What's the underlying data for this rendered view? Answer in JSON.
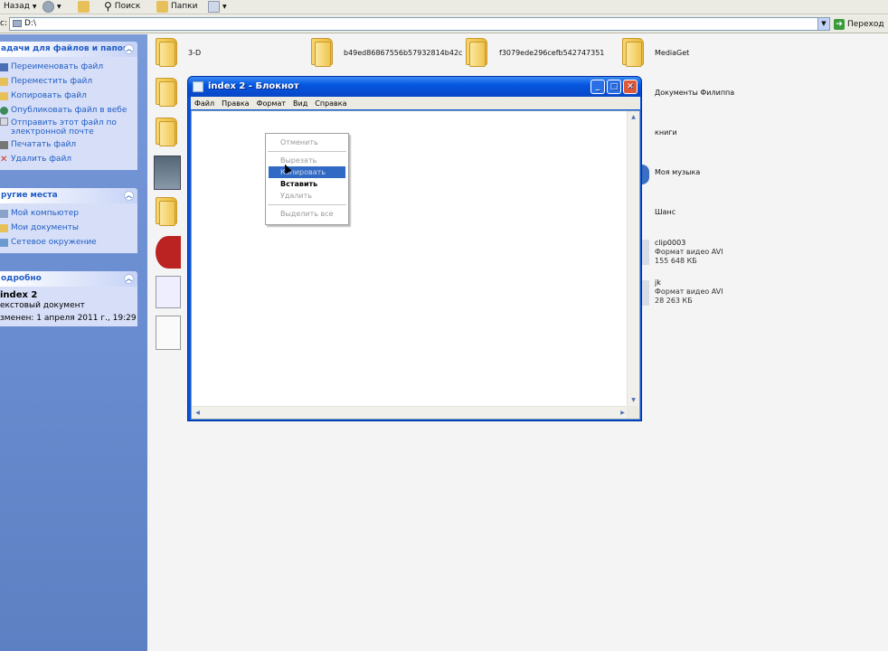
{
  "toolbar": {
    "back_label": "Назад",
    "search_label": "Поиск",
    "folders_label": "Папки"
  },
  "address": {
    "prefix": "с:",
    "value": "D:\\",
    "go_label": "Переход"
  },
  "tasks_panel": {
    "title": "адачи для файлов и папок",
    "items": [
      {
        "label": "Переименовать файл",
        "icon": "rename-icon"
      },
      {
        "label": "Переместить файл",
        "icon": "move-icon"
      },
      {
        "label": "Копировать файл",
        "icon": "copy-icon"
      },
      {
        "label": "Опубликовать файл в вебе",
        "icon": "web-icon"
      },
      {
        "label": "Отправить этот файл по электронной почте",
        "icon": "mail-icon"
      },
      {
        "label": "Печатать файл",
        "icon": "print-icon"
      },
      {
        "label": "Удалить файл",
        "icon": "delete-icon"
      }
    ]
  },
  "places_panel": {
    "title": "ругие места",
    "items": [
      {
        "label": "Мой компьютер",
        "icon": "computer-icon"
      },
      {
        "label": "Мои документы",
        "icon": "documents-icon"
      },
      {
        "label": "Сетевое окружение",
        "icon": "network-icon"
      }
    ]
  },
  "details_panel": {
    "title": "одробно",
    "name": "index 2",
    "type": "екстовый документ",
    "modified": "зменен: 1 апреля 2011 г., 19:29"
  },
  "files": {
    "f1": {
      "name": "3-D"
    },
    "f2": {
      "name": "b49ed86867556b57932814b42c"
    },
    "f3": {
      "name": "f3079ede296cefb542747351"
    },
    "f4": {
      "name": "MediaGet"
    },
    "f5": {
      "name": "Документы Филиппа"
    },
    "f6": {
      "name": "книги"
    },
    "f7": {
      "name": "Моя музыка"
    },
    "f8": {
      "name": "Шанс"
    },
    "f9": {
      "name": "clip0003",
      "type": "Формат видео AVI",
      "size": "155 648 КБ"
    },
    "f10": {
      "name": "jk",
      "type": "Формат видео AVI",
      "size": "28 263 КБ"
    }
  },
  "notepad": {
    "title": "index 2 - Блокнот",
    "menus": [
      "Файл",
      "Правка",
      "Формат",
      "Вид",
      "Справка"
    ]
  },
  "context_menu": {
    "undo": "Отменить",
    "cut": "Вырезать",
    "copy": "Копировать",
    "paste": "Вставить",
    "delete": "Удалить",
    "select_all": "Выделить все"
  },
  "colors": {
    "accent": "#215dc6",
    "title_bar": "#0846c6",
    "selection": "#316ac5"
  }
}
